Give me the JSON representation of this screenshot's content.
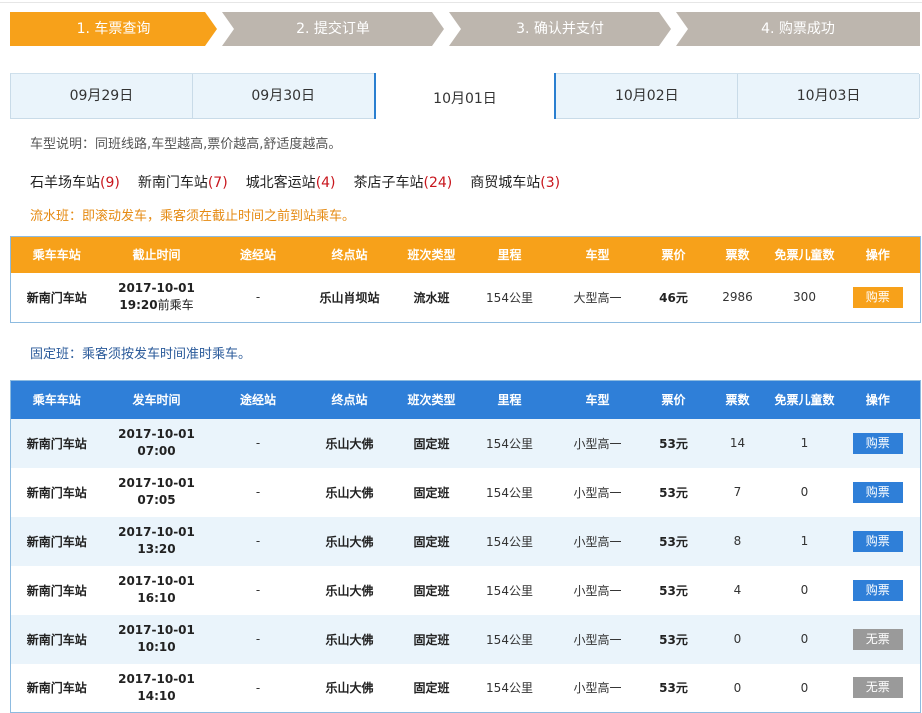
{
  "steps": [
    {
      "label": "1. 车票查询",
      "color": "#f7a11a"
    },
    {
      "label": "2. 提交订单",
      "color": "#bdb6ae"
    },
    {
      "label": "3. 确认并支付",
      "color": "#bdb6ae"
    },
    {
      "label": "4. 购票成功",
      "color": "#bdb6ae"
    }
  ],
  "dates": [
    "09月29日",
    "09月30日",
    "10月01日",
    "10月02日",
    "10月03日"
  ],
  "active_date": "10月01日",
  "notes": {
    "type": "车型说明：同班线路,车型越高,票价越高,舒适度越高。",
    "flow": "流水班：即滚动发车，乘客须在截止时间之前到站乘车。",
    "fixed": "固定班：乘客须按发车时间准时乘车。"
  },
  "stations": [
    {
      "name": "石羊场车站",
      "count": "(9)"
    },
    {
      "name": "新南门车站",
      "count": "(7)"
    },
    {
      "name": "城北客运站",
      "count": "(4)"
    },
    {
      "name": "茶店子车站",
      "count": "(24)"
    },
    {
      "name": "商贸城车站",
      "count": "(3)"
    }
  ],
  "flow_table": {
    "headers": [
      "乘车车站",
      "截止时间",
      "途经站",
      "终点站",
      "班次类型",
      "里程",
      "车型",
      "票价",
      "票数",
      "免票儿童数",
      "操作"
    ],
    "rows": [
      {
        "station": "新南门车站",
        "date": "2017-10-01",
        "time": "19:20",
        "time_suffix": "前乘车",
        "via": "-",
        "dest": "乐山肖坝站",
        "type": "流水班",
        "distance": "154公里",
        "bus": "大型高一",
        "price": "46元",
        "tickets": "2986",
        "children": "300",
        "action": "购票"
      }
    ]
  },
  "fixed_table": {
    "headers": [
      "乘车车站",
      "发车时间",
      "途经站",
      "终点站",
      "班次类型",
      "里程",
      "车型",
      "票价",
      "票数",
      "免票儿童数",
      "操作"
    ],
    "rows": [
      {
        "station": "新南门车站",
        "date": "2017-10-01",
        "time": "07:00",
        "via": "-",
        "dest": "乐山大佛",
        "type": "固定班",
        "distance": "154公里",
        "bus": "小型高一",
        "price": "53元",
        "tickets": "14",
        "children": "1",
        "action": "购票",
        "state": "buy"
      },
      {
        "station": "新南门车站",
        "date": "2017-10-01",
        "time": "07:05",
        "via": "-",
        "dest": "乐山大佛",
        "type": "固定班",
        "distance": "154公里",
        "bus": "小型高一",
        "price": "53元",
        "tickets": "7",
        "children": "0",
        "action": "购票",
        "state": "buy"
      },
      {
        "station": "新南门车站",
        "date": "2017-10-01",
        "time": "13:20",
        "via": "-",
        "dest": "乐山大佛",
        "type": "固定班",
        "distance": "154公里",
        "bus": "小型高一",
        "price": "53元",
        "tickets": "8",
        "children": "1",
        "action": "购票",
        "state": "buy"
      },
      {
        "station": "新南门车站",
        "date": "2017-10-01",
        "time": "16:10",
        "via": "-",
        "dest": "乐山大佛",
        "type": "固定班",
        "distance": "154公里",
        "bus": "小型高一",
        "price": "53元",
        "tickets": "4",
        "children": "0",
        "action": "购票",
        "state": "buy"
      },
      {
        "station": "新南门车站",
        "date": "2017-10-01",
        "time": "10:10",
        "via": "-",
        "dest": "乐山大佛",
        "type": "固定班",
        "distance": "154公里",
        "bus": "小型高一",
        "price": "53元",
        "tickets": "0",
        "children": "0",
        "action": "无票",
        "state": "none"
      },
      {
        "station": "新南门车站",
        "date": "2017-10-01",
        "time": "14:10",
        "via": "-",
        "dest": "乐山大佛",
        "type": "固定班",
        "distance": "154公里",
        "bus": "小型高一",
        "price": "53元",
        "tickets": "0",
        "children": "0",
        "action": "无票",
        "state": "none"
      }
    ]
  }
}
